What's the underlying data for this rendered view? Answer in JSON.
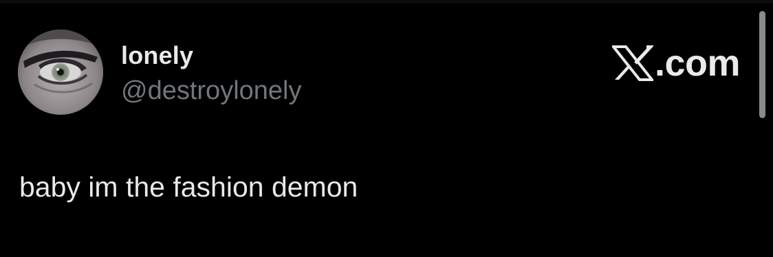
{
  "tweet": {
    "display_name": "lonely",
    "handle": "@destroylonely",
    "text": "baby im the fashion demon"
  },
  "brand": {
    "label": ".com",
    "icon": "x-logo-icon"
  },
  "avatar": {
    "icon": "avatar-eye-image"
  },
  "colors": {
    "background": "#000000",
    "primary_text": "#e7e9ea",
    "secondary_text": "#71767b",
    "scrollbar": "#8a8a8a"
  }
}
